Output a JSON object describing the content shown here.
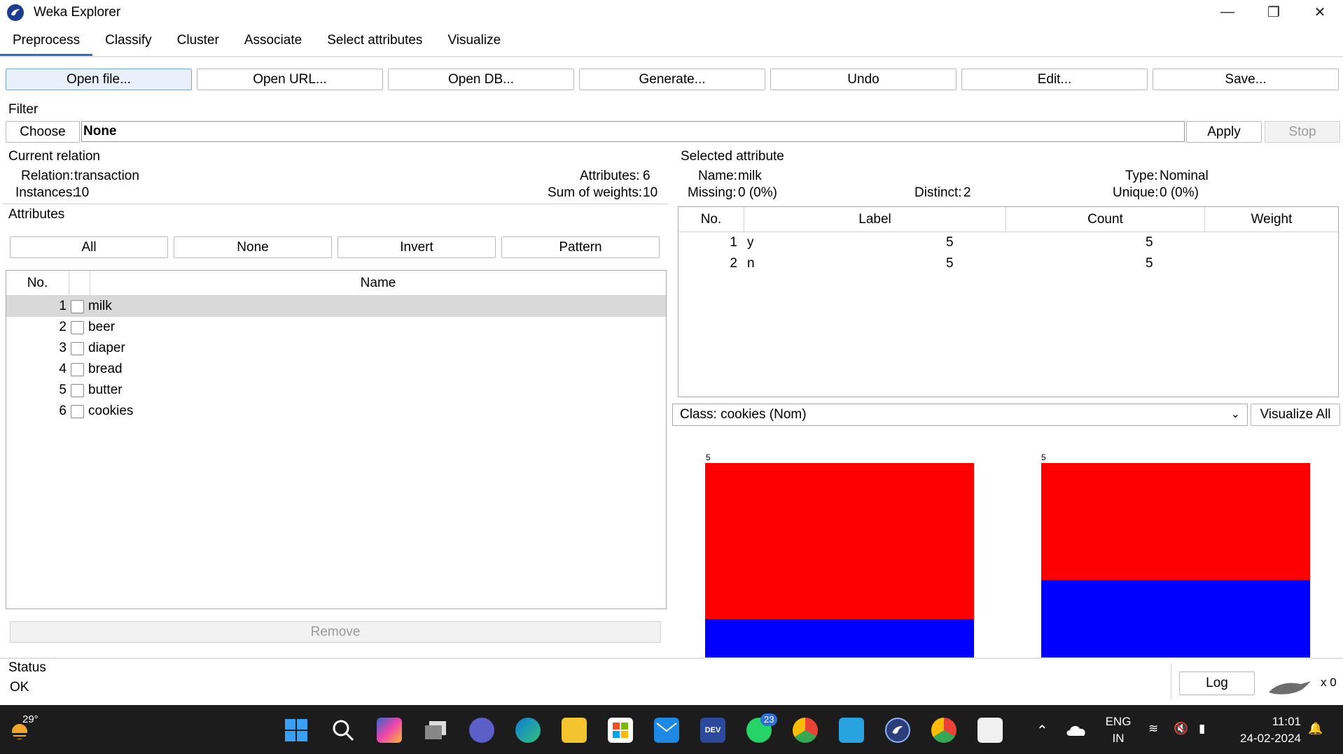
{
  "window": {
    "title": "Weka Explorer",
    "minimize": "—",
    "maximize": "❐",
    "close": "✕"
  },
  "tabs": [
    "Preprocess",
    "Classify",
    "Cluster",
    "Associate",
    "Select attributes",
    "Visualize"
  ],
  "toolbar": [
    "Open file...",
    "Open URL...",
    "Open DB...",
    "Generate...",
    "Undo",
    "Edit...",
    "Save..."
  ],
  "filter": {
    "label": "Filter",
    "choose": "Choose",
    "value": "None",
    "apply": "Apply",
    "stop": "Stop"
  },
  "current_relation": {
    "label": "Current relation",
    "relation_key": "Relation:",
    "relation": "transaction",
    "instances_key": "Instances:",
    "instances": "10",
    "attributes_key": "Attributes:",
    "attributes": "6",
    "weights_key": "Sum of weights:",
    "weights": "10"
  },
  "attributes": {
    "label": "Attributes",
    "buttons": [
      "All",
      "None",
      "Invert",
      "Pattern"
    ],
    "col_no": "No.",
    "col_name": "Name",
    "rows": [
      {
        "no": "1",
        "name": "milk"
      },
      {
        "no": "2",
        "name": "beer"
      },
      {
        "no": "3",
        "name": "diaper"
      },
      {
        "no": "4",
        "name": "bread"
      },
      {
        "no": "5",
        "name": "butter"
      },
      {
        "no": "6",
        "name": "cookies"
      }
    ],
    "remove": "Remove"
  },
  "selected_attribute": {
    "label": "Selected attribute",
    "name_key": "Name:",
    "name": "milk",
    "type_key": "Type:",
    "type": "Nominal",
    "missing_key": "Missing:",
    "missing": "0 (0%)",
    "distinct_key": "Distinct:",
    "distinct": "2",
    "unique_key": "Unique:",
    "unique": "0 (0%)",
    "columns": [
      "No.",
      "Label",
      "Count",
      "Weight"
    ],
    "rows": [
      {
        "no": "1",
        "label": "y",
        "count": "5",
        "weight": "5"
      },
      {
        "no": "2",
        "label": "n",
        "count": "5",
        "weight": "5"
      }
    ]
  },
  "class_select": {
    "value": "Class: cookies (Nom)",
    "visualize_all": "Visualize All"
  },
  "histogram": {
    "bars": [
      {
        "label": "5",
        "total": 5,
        "red": 4,
        "blue": 1
      },
      {
        "label": "5",
        "total": 5,
        "red": 3,
        "blue": 2
      }
    ],
    "colors": {
      "red": "#ff0000",
      "blue": "#0000ff"
    }
  },
  "status": {
    "label": "Status",
    "text": "OK",
    "log": "Log",
    "count": "x 0"
  },
  "taskbar": {
    "weather": "29°",
    "whatsapp_badge": "23",
    "lang_top": "ENG",
    "lang_bottom": "IN",
    "time": "11:01",
    "date": "24-02-2024"
  }
}
